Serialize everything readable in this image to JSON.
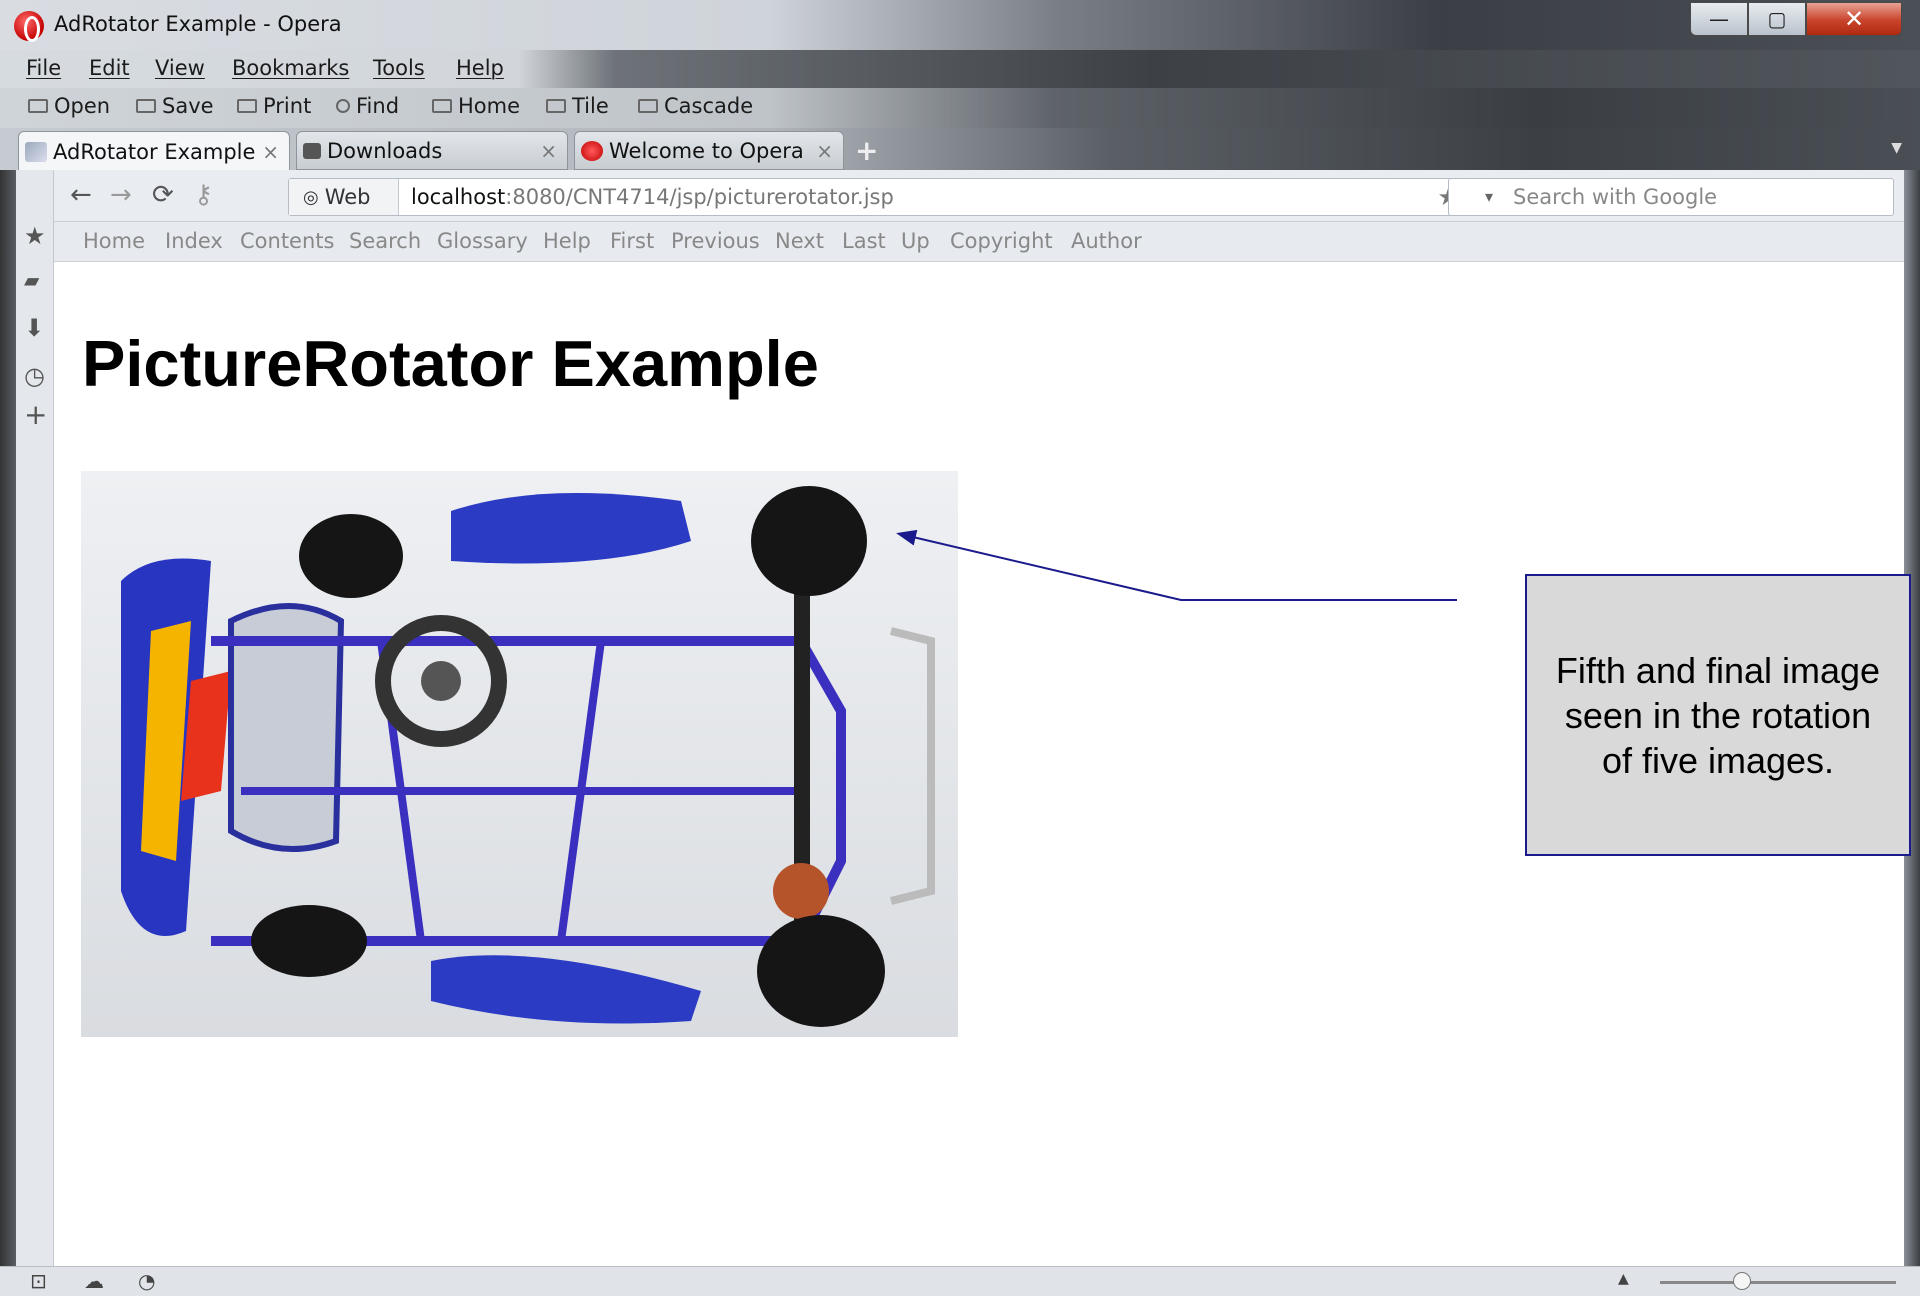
{
  "window": {
    "title": "AdRotator Example - Opera",
    "minimize": "—",
    "maximize": "▢",
    "close": "✕"
  },
  "menu": [
    "File",
    "Edit",
    "View",
    "Bookmarks",
    "Tools",
    "Help"
  ],
  "toolbar": [
    "Open",
    "Save",
    "Print",
    "Find",
    "Home",
    "Tile",
    "Cascade"
  ],
  "tabs": [
    {
      "label": "AdRotator Example",
      "active": true
    },
    {
      "label": "Downloads",
      "active": false
    },
    {
      "label": "Welcome to Opera",
      "active": false
    }
  ],
  "address": {
    "web_label": "Web",
    "host": "localhost",
    "path": ":8080/CNT4714/jsp/picturerotator.jsp"
  },
  "search": {
    "placeholder": "Search with Google"
  },
  "links": [
    "Home",
    "Index",
    "Contents",
    "Search",
    "Glossary",
    "Help",
    "First",
    "Previous",
    "Next",
    "Last",
    "Up",
    "Copyright",
    "Author"
  ],
  "page": {
    "heading": "PictureRotator Example",
    "image_subject": "go-kart (top view, blue frame)"
  },
  "annotation": {
    "text": "Fifth and final image seen in the rotation of five images.",
    "color": "#1a1a8c"
  },
  "icons": {
    "back": "←",
    "forward": "→",
    "reload": "⟳",
    "key": "⚷",
    "star": "★",
    "panel_bookmarks": "★",
    "panel_notes": "▰",
    "panel_downloads": "⬇",
    "panel_history": "◷",
    "panel_add": "+"
  }
}
